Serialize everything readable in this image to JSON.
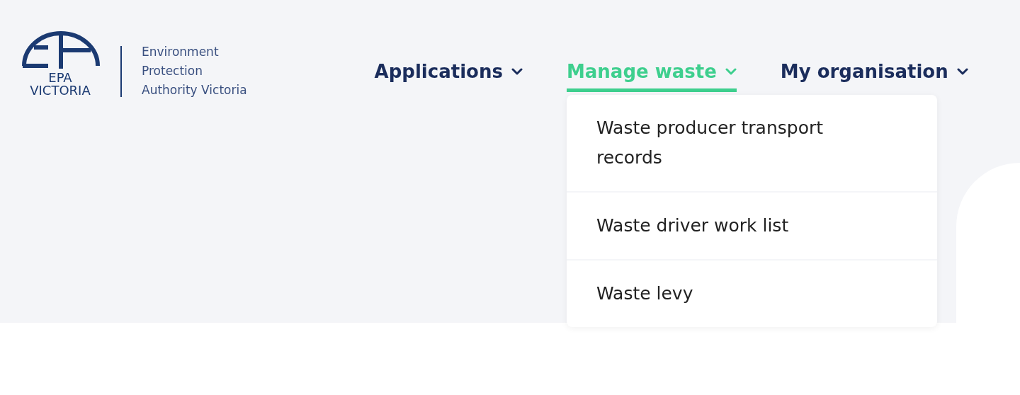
{
  "logo": {
    "line_1": "EPA",
    "line_2": "VICTORIA",
    "agency": [
      "Environment",
      "Protection",
      "Authority Victoria"
    ]
  },
  "nav": [
    {
      "label": "Applications",
      "selected": false
    },
    {
      "label": "Manage waste",
      "selected": true,
      "menu": [
        "Waste producer transport records",
        "Waste driver work list",
        "Waste levy"
      ]
    },
    {
      "label": "My organisation",
      "selected": false
    }
  ]
}
